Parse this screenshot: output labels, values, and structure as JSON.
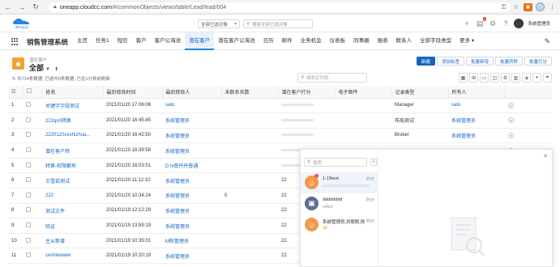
{
  "browser": {
    "url_host": "oneapp.cloudcc.com",
    "url_path": "/#/commonObjects/views/table/Lead/lead/004"
  },
  "header": {
    "logo_text": "神州云动",
    "global_filter": "全部已选对象",
    "global_search_placeholder": "搜索全部已选对象",
    "user_name": "系统管理员",
    "notification_count": "2"
  },
  "nav": {
    "app_name": "销售管理系统",
    "items": [
      {
        "label": "主页"
      },
      {
        "label": "任务1"
      },
      {
        "label": "短信"
      },
      {
        "label": "客户"
      },
      {
        "label": "客户公海池"
      },
      {
        "label": "潜在客户",
        "active": true
      },
      {
        "label": "潜在客户公海池"
      },
      {
        "label": "日历"
      },
      {
        "label": "邮件"
      },
      {
        "label": "业务机会"
      },
      {
        "label": "仪表板"
      },
      {
        "label": "同事圈"
      },
      {
        "label": "报表"
      },
      {
        "label": "联系人"
      },
      {
        "label": "全部字段类型"
      },
      {
        "label": "更多 ▾"
      }
    ]
  },
  "list": {
    "object_label": "潜在客户",
    "view_name": "全部",
    "status_text": "共714条数据, 已选中0条数据, 已在1分钟前刷新",
    "search_placeholder": "搜索此列表",
    "actions": [
      "新建",
      "添加标签",
      "批量新增",
      "批量转移",
      "批量打分"
    ]
  },
  "table": {
    "columns": [
      "",
      "",
      "姓名",
      "最后修改时间",
      "最后修改人",
      "未联系天数",
      "潜在客户打分",
      "电子邮件",
      "记录类型",
      "所有人",
      ""
    ],
    "rows": [
      {
        "no": "1",
        "name": "关键字字段测试",
        "modified": "2021/01/20 17:06:06",
        "modifier": "sato",
        "days": "",
        "score": "",
        "email": "",
        "record_type": "Manager",
        "owner": "sato"
      },
      {
        "no": "2",
        "name": "222qsh转换",
        "modified": "2021/01/20 16:45:45",
        "modifier": "系统管理员",
        "days": "",
        "score": "",
        "email": "",
        "record_type": "布局测试",
        "owner": "系统管理员"
      },
      {
        "no": "3",
        "name": "2220120ceshizhua...",
        "modified": "2021/01/20 16:42:50",
        "modifier": "系统管理员",
        "days": "",
        "score": "",
        "email": "",
        "record_type": "Broker",
        "owner": "系统管理员"
      },
      {
        "no": "4",
        "name": "潜在客户转",
        "modified": "2021/01/20 16:39:58",
        "modifier": "系统管理员",
        "days": "",
        "score": "",
        "email": "",
        "record_type": "",
        "owner": ""
      },
      {
        "no": "5",
        "name": "转换-权限都有",
        "modified": "2021/01/20 16:03:51",
        "modifier": "D N普丹丹普通",
        "days": "",
        "score": "",
        "email": "",
        "record_type": "",
        "owner": ""
      },
      {
        "no": "6",
        "name": "王雪茹测试",
        "modified": "2021/01/20 11:12:10",
        "modifier": "系统管理员",
        "days": "",
        "score": "22",
        "email": "",
        "record_type": "",
        "owner": ""
      },
      {
        "no": "7",
        "name": "222",
        "modified": "2021/01/20 10:34:24",
        "modifier": "系统管理员",
        "days": "0",
        "score": "22",
        "email": "",
        "record_type": "",
        "owner": ""
      },
      {
        "no": "8",
        "name": "测试文件",
        "modified": "2021/01/19 12:12:29",
        "modifier": "系统管理员",
        "days": "",
        "score": "22",
        "email": "",
        "record_type": "",
        "owner": ""
      },
      {
        "no": "9",
        "name": "验证",
        "modified": "2021/01/19 13:59:19",
        "modifier": "系统管理员",
        "days": "",
        "score": "22",
        "email": "",
        "record_type": "",
        "owner": ""
      },
      {
        "no": "10",
        "name": "主从新增",
        "modified": "2021/01/19 10:35:01",
        "modifier": "M陈管理员",
        "days": "",
        "score": "22",
        "email": "",
        "record_type": "",
        "owner": ""
      },
      {
        "no": "11",
        "name": "ceshiwwww",
        "modified": "2021/01/19 10:20:19",
        "modifier": "系统管理员",
        "days": "",
        "score": "22",
        "email": "",
        "record_type": "",
        "owner": ""
      }
    ]
  },
  "chat": {
    "search_placeholder": "搜索",
    "conversations": [
      {
        "name": "1-15test",
        "time": "昨天",
        "preview": "",
        "badge": "1",
        "avatar": "orange"
      },
      {
        "name": "dddddddd",
        "time": "昨天",
        "preview": "rolled",
        "badge": "",
        "avatar": "grey"
      },
      {
        "name": "系统管理员,刘聪聪,陈",
        "time": "昨天",
        "preview": "😀",
        "badge": "",
        "avatar": "orange"
      }
    ]
  },
  "colors": {
    "primary": "#1565c0",
    "accent_orange": "#f4a133",
    "nav_active_bg": "#e8f1fb"
  }
}
